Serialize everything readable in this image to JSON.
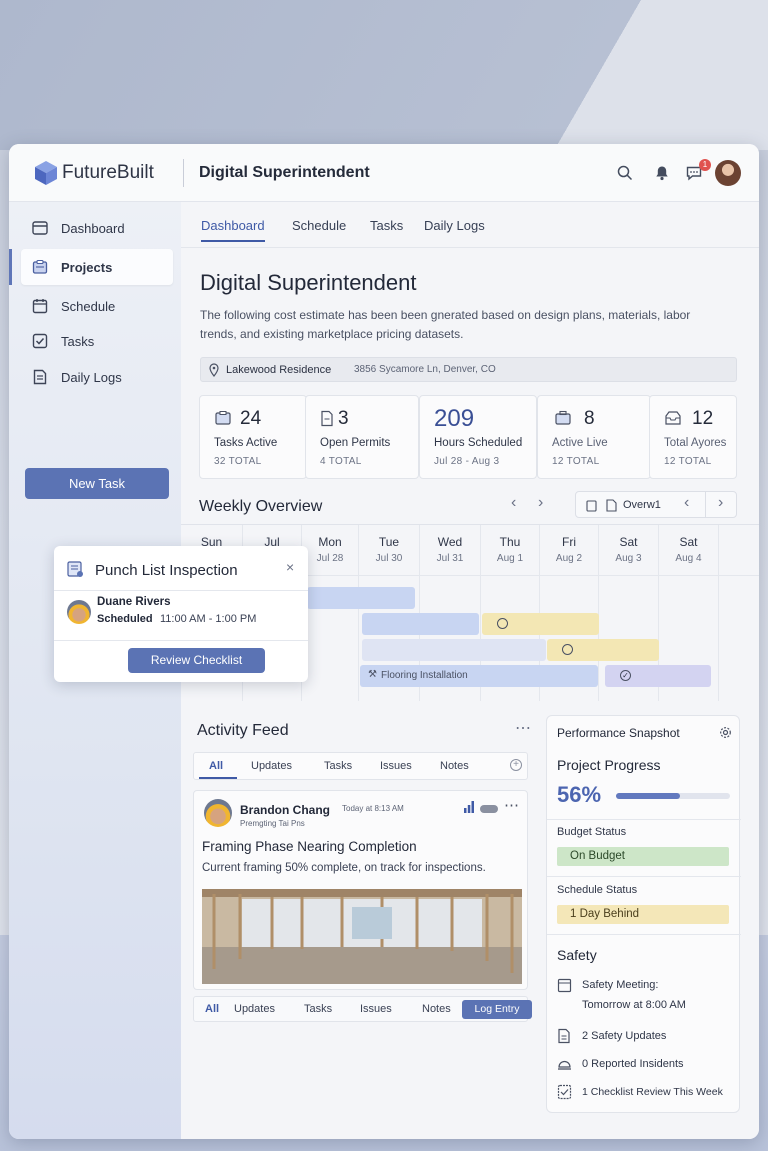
{
  "header": {
    "brand": "FutureBuilt",
    "title": "Digital Superintendent",
    "notification_count": "1"
  },
  "sidebar": {
    "items": [
      {
        "label": "Dashboard",
        "icon": "dashboard-icon"
      },
      {
        "label": "Projects",
        "icon": "projects-icon"
      },
      {
        "label": "Schedule",
        "icon": "calendar-icon"
      },
      {
        "label": "Tasks",
        "icon": "checkbox-icon"
      },
      {
        "label": "Daily Logs",
        "icon": "log-icon"
      }
    ],
    "active_index": 1,
    "new_task_label": "New Task"
  },
  "tabs": [
    "Dashboard",
    "Schedule",
    "Tasks",
    "Daily Logs"
  ],
  "page": {
    "title": "Digital Superintendent",
    "description": "The following cost estimate has been been gnerated based on design plans, materials, labor trends, and existing marketplace pricing datasets.",
    "location_name": "Lakewood Residence",
    "location_address": "3856 Sycamore Ln, Denver, CO"
  },
  "stats": [
    {
      "value": "24",
      "label": "Tasks Active",
      "sub": "32  TOTAL"
    },
    {
      "value": "3",
      "label": "Open Permits",
      "sub": "4  TOTAL"
    },
    {
      "value": "209",
      "label": "Hours Scheduled",
      "sub": "Jul 28 - Aug 3"
    },
    {
      "value": "8",
      "label": "Active Live",
      "sub": "12  TOTAL"
    },
    {
      "value": "12",
      "label": "Total Ayores",
      "sub": "12  TOTAL"
    }
  ],
  "weekly": {
    "title": "Weekly Overview",
    "view_label": "Overw1",
    "days": [
      {
        "name": "Sun",
        "date": ""
      },
      {
        "name": "Jul",
        "date": ""
      },
      {
        "name": "Mon",
        "date": "Jul 28"
      },
      {
        "name": "Tue",
        "date": "Jul 30"
      },
      {
        "name": "Wed",
        "date": "Jul 31"
      },
      {
        "name": "Thu",
        "date": "Aug 1"
      },
      {
        "name": "Fri",
        "date": "Aug 2"
      },
      {
        "name": "Sat",
        "date": "Aug 3"
      },
      {
        "name": "Sat",
        "date": "Aug 4"
      }
    ],
    "bar_label": "Flooring Installation",
    "colors": {
      "blue": "#c8d5f2",
      "yellow": "#f3e7b4",
      "purple": "#d3d3f1"
    }
  },
  "popup": {
    "title": "Punch List Inspection",
    "person": "Duane Rivers",
    "status_label": "Scheduled",
    "time": "11:00 AM - 1:00 PM",
    "button": "Review Checklist"
  },
  "feed": {
    "title": "Activity Feed",
    "tabs": [
      "All",
      "Updates",
      "Tasks",
      "Issues",
      "Notes"
    ],
    "post": {
      "author": "Brandon Chang",
      "time": "Today at 8:13 AM",
      "subtitle": "Premgting Tai Pns",
      "headline": "Framing Phase Nearing Completion",
      "body": "Current framing 50% complete, on track for inspections."
    },
    "bottom_tabs": [
      "All",
      "Updates",
      "Tasks",
      "Issues",
      "Notes"
    ],
    "log_entry": "Log Entry"
  },
  "performance": {
    "title": "Performance Snapshot",
    "progress_label": "Project Progress",
    "progress_value": "56%",
    "progress_fraction": 0.56,
    "budget_label": "Budget Status",
    "budget_value": "On Budget",
    "schedule_label": "Schedule Status",
    "schedule_value": "1 Day Behind",
    "safety_title": "Safety",
    "safety_items": [
      {
        "line1": "Safety Meeting:",
        "line2": "Tomorrow at 8:00 AM"
      },
      {
        "line1": "2 Safety Updates",
        "line2": ""
      },
      {
        "line1": "0 Reported Insidents",
        "line2": ""
      },
      {
        "line1": "1 Checklist Review This Week",
        "line2": ""
      }
    ],
    "colors": {
      "accent": "#5b73b4",
      "budget": "#cde6c8",
      "schedule": "#f4e7b8"
    }
  }
}
